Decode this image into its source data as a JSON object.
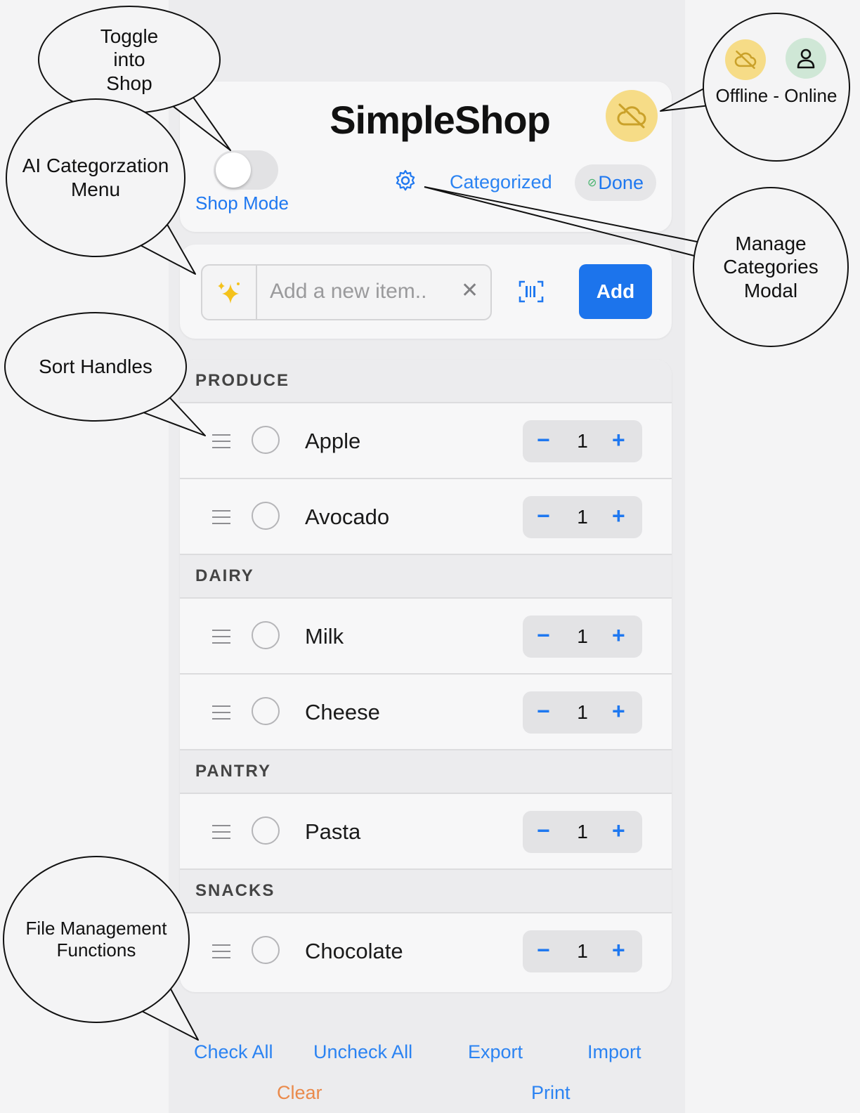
{
  "app": {
    "title": "SimpleShop",
    "shop_mode_label": "Shop Mode",
    "categorized_label": "Categorized",
    "done_label": "Done",
    "done_icon": "check-circle-icon",
    "cloud_icon": "cloud-off-icon",
    "toggle_on": false
  },
  "input": {
    "placeholder": "Add a new item..",
    "ai_icon": "sparkles-icon",
    "scan_icon": "barcode-scan-icon",
    "add_label": "Add"
  },
  "sections": [
    {
      "name": "PRODUCE",
      "items": [
        {
          "name": "Apple",
          "qty": "1"
        },
        {
          "name": "Avocado",
          "qty": "1"
        }
      ]
    },
    {
      "name": "DAIRY",
      "items": [
        {
          "name": "Milk",
          "qty": "1"
        },
        {
          "name": "Cheese",
          "qty": "1"
        }
      ]
    },
    {
      "name": "PANTRY",
      "items": [
        {
          "name": "Pasta",
          "qty": "1"
        }
      ]
    },
    {
      "name": "SNACKS",
      "items": [
        {
          "name": "Chocolate",
          "qty": "1"
        }
      ]
    }
  ],
  "stepper": {
    "minus": "−",
    "plus": "+"
  },
  "footer": {
    "check_all": "Check All",
    "uncheck_all": "Uncheck All",
    "export": "Export",
    "import": "Import",
    "clear": "Clear",
    "print": "Print"
  },
  "annotations": {
    "toggle": "Toggle\ninto\nShop",
    "ai_menu": "AI Categorzation\nMenu",
    "sort_handles": "Sort Handles",
    "file_management": "File Management\nFunctions",
    "offline_online": "Offline - Online",
    "manage_categories": "Manage\nCategories\nModal"
  },
  "colors": {
    "accent": "#1f78f0",
    "add_button": "#1c74ec",
    "offline_badge": "#f6dc87",
    "online_badge": "#cfe7d6",
    "clear_link": "#ea8a4b"
  }
}
